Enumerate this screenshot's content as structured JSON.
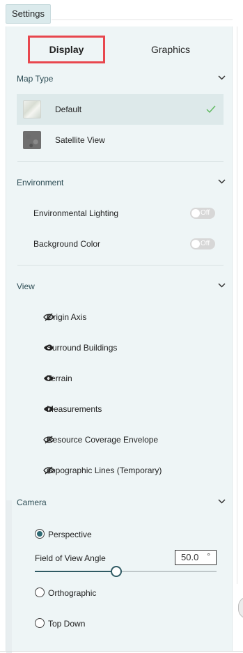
{
  "settings_button": "Settings",
  "tabs": [
    {
      "label": "Display",
      "active": true
    },
    {
      "label": "Graphics",
      "active": false
    }
  ],
  "map_type": {
    "header": "Map Type",
    "options": [
      {
        "label": "Default",
        "selected": true,
        "thumb": "default-map"
      },
      {
        "label": "Satellite View",
        "selected": false,
        "thumb": "satellite-map"
      }
    ]
  },
  "environment": {
    "header": "Environment",
    "items": [
      {
        "label": "Environmental Lighting",
        "state": "Off"
      },
      {
        "label": "Background Color",
        "state": "Off"
      }
    ]
  },
  "view": {
    "header": "View",
    "items": [
      {
        "label": "Origin Axis",
        "visible": false
      },
      {
        "label": "Surround Buildings",
        "visible": true
      },
      {
        "label": "Terrain",
        "visible": true
      },
      {
        "label": "Measurements",
        "visible": true
      },
      {
        "label": "Resource Coverage Envelope",
        "visible": false
      },
      {
        "label": "Topographic Lines (Temporary)",
        "visible": false
      }
    ]
  },
  "camera": {
    "header": "Camera",
    "options": [
      {
        "label": "Perspective",
        "selected": true
      },
      {
        "label": "Orthographic",
        "selected": false
      },
      {
        "label": "Top Down",
        "selected": false
      }
    ],
    "fov_label": "Field of View Angle",
    "fov_value": "50.0",
    "fov_unit": "°",
    "fov_fraction": 0.45
  },
  "colors": {
    "accent": "#2f5a63",
    "check": "#5cb85c",
    "highlight_border": "#e8474e"
  }
}
